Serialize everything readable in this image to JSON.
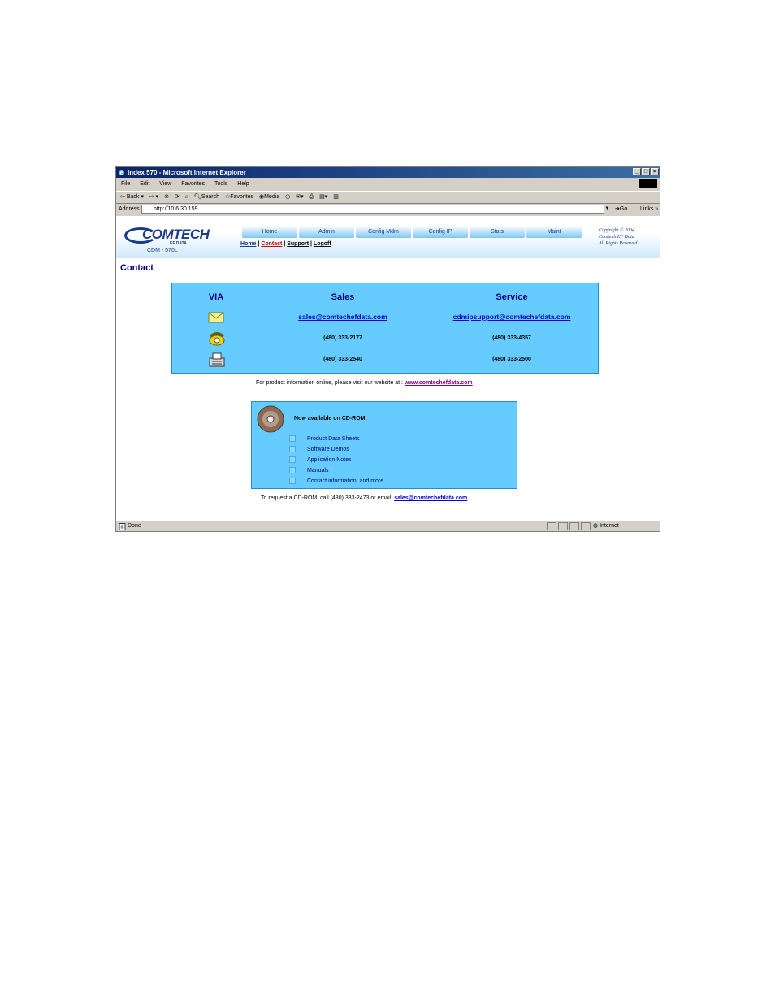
{
  "window": {
    "title": "Index 570 - Microsoft Internet Explorer",
    "buttons": [
      "_",
      "□",
      "×"
    ]
  },
  "menubar": [
    "File",
    "Edit",
    "View",
    "Favorites",
    "Tools",
    "Help"
  ],
  "toolbar": {
    "back": "Back",
    "search": "Search",
    "favorites": "Favorites",
    "media": "Media"
  },
  "address": {
    "label": "Address",
    "url": "http://10.6.30.159",
    "go": "Go",
    "links": "Links"
  },
  "header": {
    "logo_text": "COMTECH",
    "logo_sub": "EF DATA",
    "model": "CDM - 570L",
    "tabs": [
      "Home",
      "Admin",
      "Config Mdm",
      "Config IP",
      "Stats",
      "Maint"
    ],
    "copyright": [
      "Copyright © 2004",
      "Comtech EF Data",
      "All Rights Reserved"
    ],
    "sublinks": [
      "Home",
      "Contact",
      "Support",
      "Logoff"
    ]
  },
  "page_title": "Contact",
  "contact_table": {
    "headers": [
      "VIA",
      "Sales",
      "Service"
    ],
    "email": {
      "sales": "sales@comtechefdata.com",
      "service": "cdmipsupport@comtechefdata.com"
    },
    "phone": {
      "sales": "(480) 333-2177",
      "service": "(480) 333-4357"
    },
    "fax": {
      "sales": "(480) 333-2540",
      "service": "(480) 333-2500"
    }
  },
  "visit": {
    "text": "For product information online, please visit our website at :",
    "link": "www.comtechefdata.com"
  },
  "cdrom": {
    "title": "Now available on CD-ROM:",
    "items": [
      "Product Data Sheets",
      "Software Demos",
      "Application Notes",
      "Manuals",
      "Contact information, and more"
    ]
  },
  "request": {
    "text": "To request a CD-ROM, call (480) 333-2473 or email:",
    "link": "sales@comtechefdata.com"
  },
  "status": {
    "left": "Done",
    "zone": "Internet"
  }
}
